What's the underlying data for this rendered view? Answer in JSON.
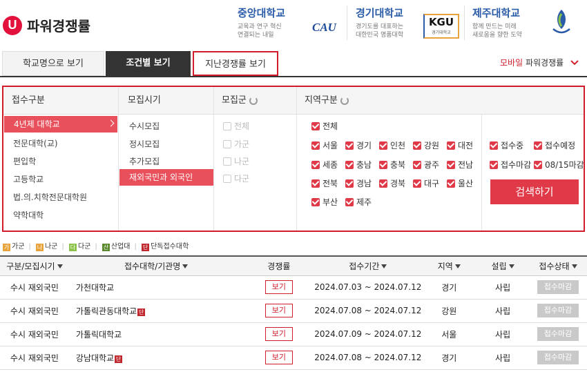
{
  "header": {
    "logo_letter": "U",
    "title": "파워경쟁률",
    "ads": [
      {
        "name": "중앙대학교",
        "desc1": "교육과 연구 혁신",
        "desc2": "연결되는 내일",
        "mark": "CAU"
      },
      {
        "name": "경기대학교",
        "desc1": "경기도를 대표하는",
        "desc2": "대한민국 명품대학",
        "mark": "KGU",
        "mark_sub": "경기대학교"
      },
      {
        "name": "제주대학교",
        "desc1": "함께 만드는 미래",
        "desc2": "새로움을 향한 도약"
      }
    ]
  },
  "tabs": {
    "by_school": "학교명으로 보기",
    "by_condition": "조건별 보기",
    "past": "지난경쟁률 보기",
    "mobile_prefix": "모바일",
    "mobile_suffix": "파워경쟁률"
  },
  "filters": {
    "headers": {
      "type": "접수구분",
      "period": "모집시기",
      "group": "모집군",
      "region": "지역구분"
    },
    "types": [
      "4년제 대학교",
      "전문대학(교)",
      "편입학",
      "고등학교",
      "법.의.치학전문대학원",
      "약학대학"
    ],
    "periods": [
      "수시모집",
      "정시모집",
      "추가모집",
      "재외국민과 외국인"
    ],
    "groups": [
      "전체",
      "가군",
      "나군",
      "다군"
    ],
    "regions_all": "전체",
    "regions": [
      "서울",
      "경기",
      "인천",
      "강원",
      "대전",
      "세종",
      "충남",
      "충북",
      "광주",
      "전남",
      "전북",
      "경남",
      "경북",
      "대구",
      "울산",
      "부산",
      "제주"
    ],
    "statuses": [
      "접수중",
      "접수예정",
      "접수마감",
      "08/15마감"
    ],
    "search": "검색하기"
  },
  "legend": [
    {
      "mark": "가",
      "label": "가군",
      "color": "#e8a33a"
    },
    {
      "mark": "나",
      "label": "나군",
      "color": "#e8a33a"
    },
    {
      "mark": "다",
      "label": "다군",
      "color": "#8bc34a"
    },
    {
      "mark": "산",
      "label": "산업대",
      "color": "#5b8a2e"
    },
    {
      "mark": "단",
      "label": "단독접수대학",
      "color": "#c0272d"
    }
  ],
  "table": {
    "headers": [
      "구분/모집시기",
      "접수대학/기관명",
      "경쟁률",
      "접수기간",
      "지역",
      "설립",
      "접수상태"
    ],
    "rows": [
      {
        "type": "수시 재외국민",
        "uni": "가천대학교",
        "tag": "",
        "btn": "보기",
        "period": "2024.07.03 ~ 2024.07.12",
        "region": "경기",
        "found": "사립",
        "status": "접수마감"
      },
      {
        "type": "수시 재외국민",
        "uni": "가톨릭관동대학교",
        "tag": "단",
        "btn": "보기",
        "period": "2024.07.08 ~ 2024.07.12",
        "region": "강원",
        "found": "사립",
        "status": "접수마감"
      },
      {
        "type": "수시 재외국민",
        "uni": "가톨릭대학교",
        "tag": "",
        "btn": "보기",
        "period": "2024.07.09 ~ 2024.07.12",
        "region": "서울",
        "found": "사립",
        "status": "접수마감"
      },
      {
        "type": "수시 재외국민",
        "uni": "강남대학교",
        "tag": "단",
        "btn": "보기",
        "period": "2024.07.08 ~ 2024.07.12",
        "region": "경기",
        "found": "사립",
        "status": "접수마감"
      }
    ]
  }
}
